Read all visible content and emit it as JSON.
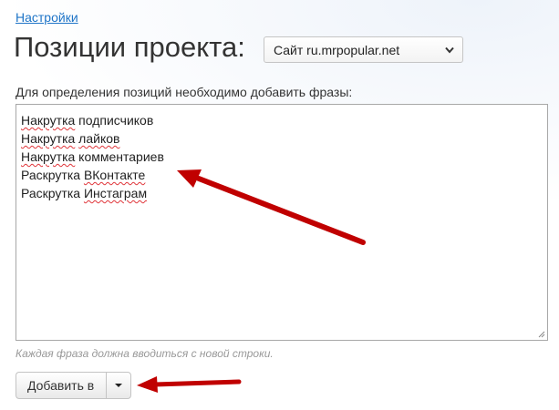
{
  "breadcrumb": {
    "settings_link": "Настройки"
  },
  "header": {
    "title": "Позиции проекта:",
    "site_select_value": "Сайт ru.mrpopular.net"
  },
  "form": {
    "label": "Для определения позиций необходимо добавить фразы:",
    "phrases": [
      {
        "word1": "Накрутка",
        "word2": "подписчиков"
      },
      {
        "word1": "Накрутка",
        "word2": "лайков"
      },
      {
        "word1": "Накрутка",
        "word2": "комментариев"
      },
      {
        "word1": "Раскрутка",
        "word2": "ВКонтакте"
      },
      {
        "word1": "Раскрутка",
        "word2": "Инстаграм"
      }
    ],
    "hint": "Каждая фраза должна вводиться с новой строки."
  },
  "actions": {
    "add_button_label": "Добавить в"
  },
  "annotations": {
    "arrow_color": "#c00000"
  },
  "colors": {
    "link": "#1e74c7",
    "text": "#333333",
    "hint": "#999999",
    "spellcheck": "#e0353a"
  }
}
